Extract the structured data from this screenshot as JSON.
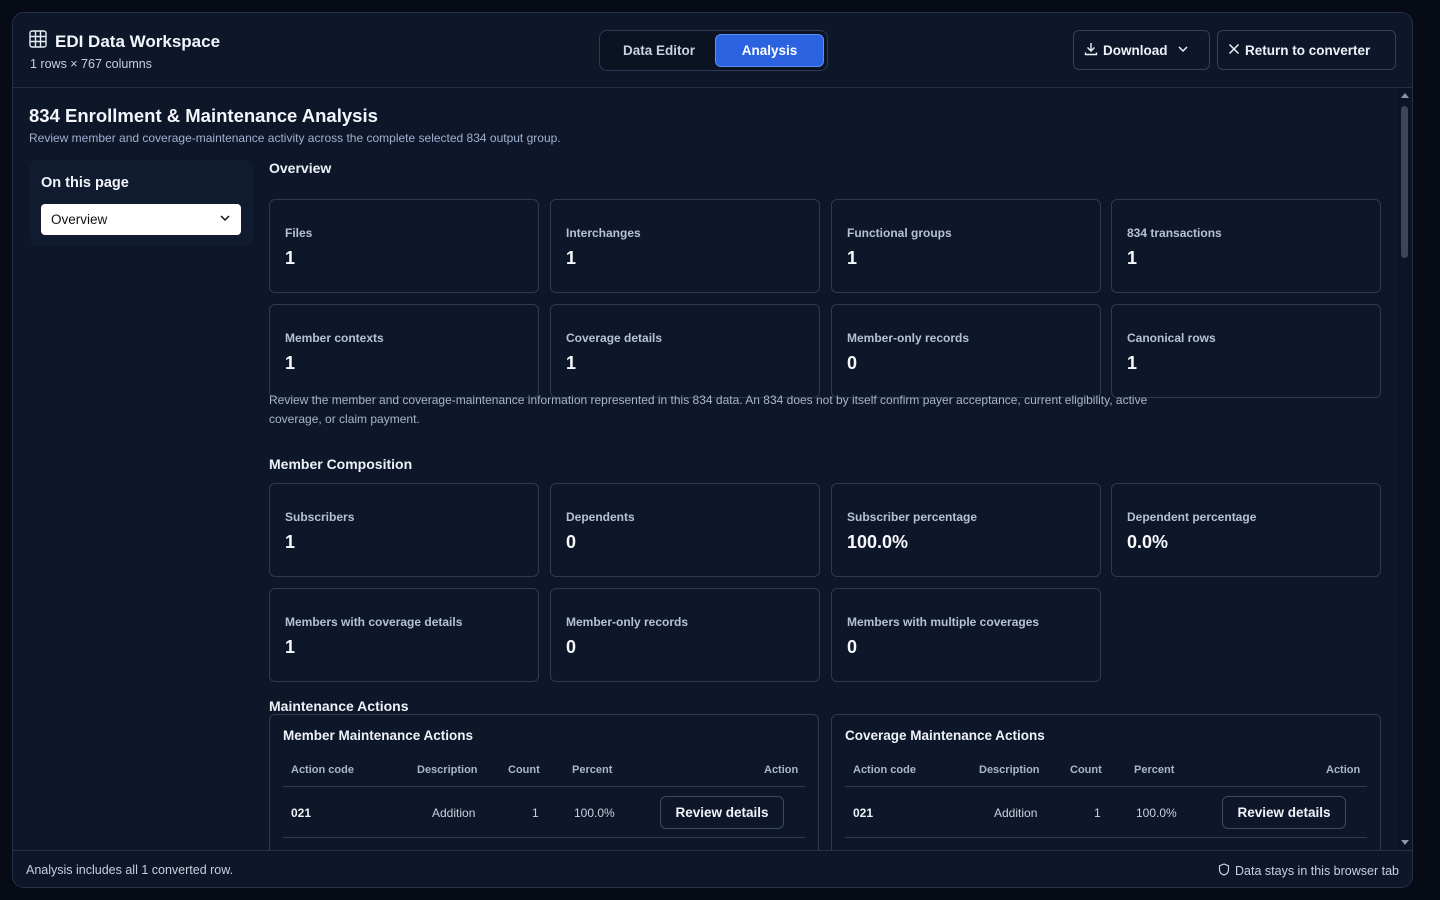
{
  "header": {
    "title": "EDI Data Workspace",
    "subtitle": "1 rows × 767 columns",
    "tabs": [
      {
        "label": "Data Editor"
      },
      {
        "label": "Analysis"
      }
    ],
    "download_label": "Download",
    "return_label": "Return to converter"
  },
  "page": {
    "title": "834 Enrollment & Maintenance Analysis",
    "subtitle": "Review member and coverage-maintenance activity across the complete selected 834 output group."
  },
  "toc": {
    "label": "On this page",
    "selected": "Overview"
  },
  "overview": {
    "heading": "Overview",
    "cards": [
      {
        "label": "Files",
        "value": "1"
      },
      {
        "label": "Interchanges",
        "value": "1"
      },
      {
        "label": "Functional groups",
        "value": "1"
      },
      {
        "label": "834 transactions",
        "value": "1"
      },
      {
        "label": "Member contexts",
        "value": "1"
      },
      {
        "label": "Coverage details",
        "value": "1"
      },
      {
        "label": "Member-only records",
        "value": "0"
      },
      {
        "label": "Canonical rows",
        "value": "1"
      }
    ],
    "note": "Review the member and coverage-maintenance information represented in this 834 data. An 834 does not by itself confirm payer acceptance, current eligibility, active coverage, or claim payment."
  },
  "composition": {
    "heading": "Member Composition",
    "cards": [
      {
        "label": "Subscribers",
        "value": "1"
      },
      {
        "label": "Dependents",
        "value": "0"
      },
      {
        "label": "Subscriber percentage",
        "value": "100.0%"
      },
      {
        "label": "Dependent percentage",
        "value": "0.0%"
      },
      {
        "label": "Members with coverage details",
        "value": "1"
      },
      {
        "label": "Member-only records",
        "value": "0"
      },
      {
        "label": "Members with multiple coverages",
        "value": "0"
      }
    ]
  },
  "maintenance": {
    "heading": "Maintenance Actions",
    "panels": [
      {
        "title": "Member Maintenance Actions",
        "columns": [
          "Action code",
          "Description",
          "Count",
          "Percent",
          "Action"
        ],
        "rows": [
          {
            "code": "021",
            "description": "Addition",
            "count": "1",
            "percent": "100.0%",
            "button": "Review details"
          }
        ]
      },
      {
        "title": "Coverage Maintenance Actions",
        "columns": [
          "Action code",
          "Description",
          "Count",
          "Percent",
          "Action"
        ],
        "rows": [
          {
            "code": "021",
            "description": "Addition",
            "count": "1",
            "percent": "100.0%",
            "button": "Review details"
          }
        ]
      }
    ]
  },
  "footer": {
    "left": "Analysis includes all 1 converted row.",
    "right": "Data stays in this browser tab"
  },
  "colors": {
    "accent": "#2a62e0",
    "background": "#0e1629",
    "border": "#2c3a55"
  }
}
